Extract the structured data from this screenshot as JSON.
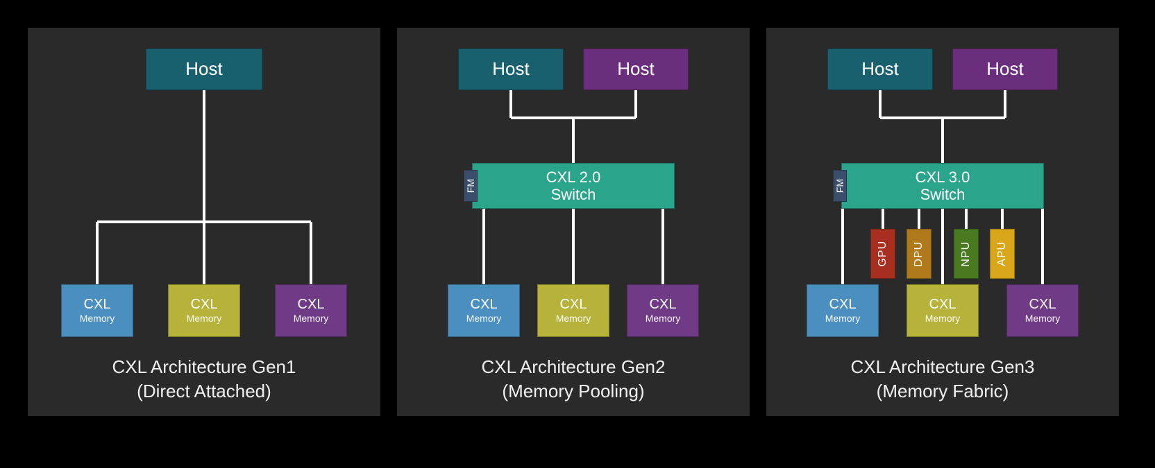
{
  "panels": [
    {
      "caption_line1": "CXL Architecture Gen1",
      "caption_line2": "(Direct Attached)",
      "host": "Host",
      "mem": {
        "title": "CXL",
        "sub": "Memory"
      }
    },
    {
      "caption_line1": "CXL Architecture Gen2",
      "caption_line2": "(Memory Pooling)",
      "host_a": "Host",
      "host_b": "Host",
      "fm": "FM",
      "switch_line1": "CXL 2.0",
      "switch_line2": "Switch",
      "mem": {
        "title": "CXL",
        "sub": "Memory"
      }
    },
    {
      "caption_line1": "CXL Architecture Gen3",
      "caption_line2": "(Memory Fabric)",
      "host_a": "Host",
      "host_b": "Host",
      "fm": "FM",
      "switch_line1": "CXL 3.0",
      "switch_line2": "Switch",
      "accel": [
        "GPU",
        "DPU",
        "NPU",
        "APU"
      ],
      "mem": {
        "title": "CXL",
        "sub": "Memory"
      }
    }
  ]
}
